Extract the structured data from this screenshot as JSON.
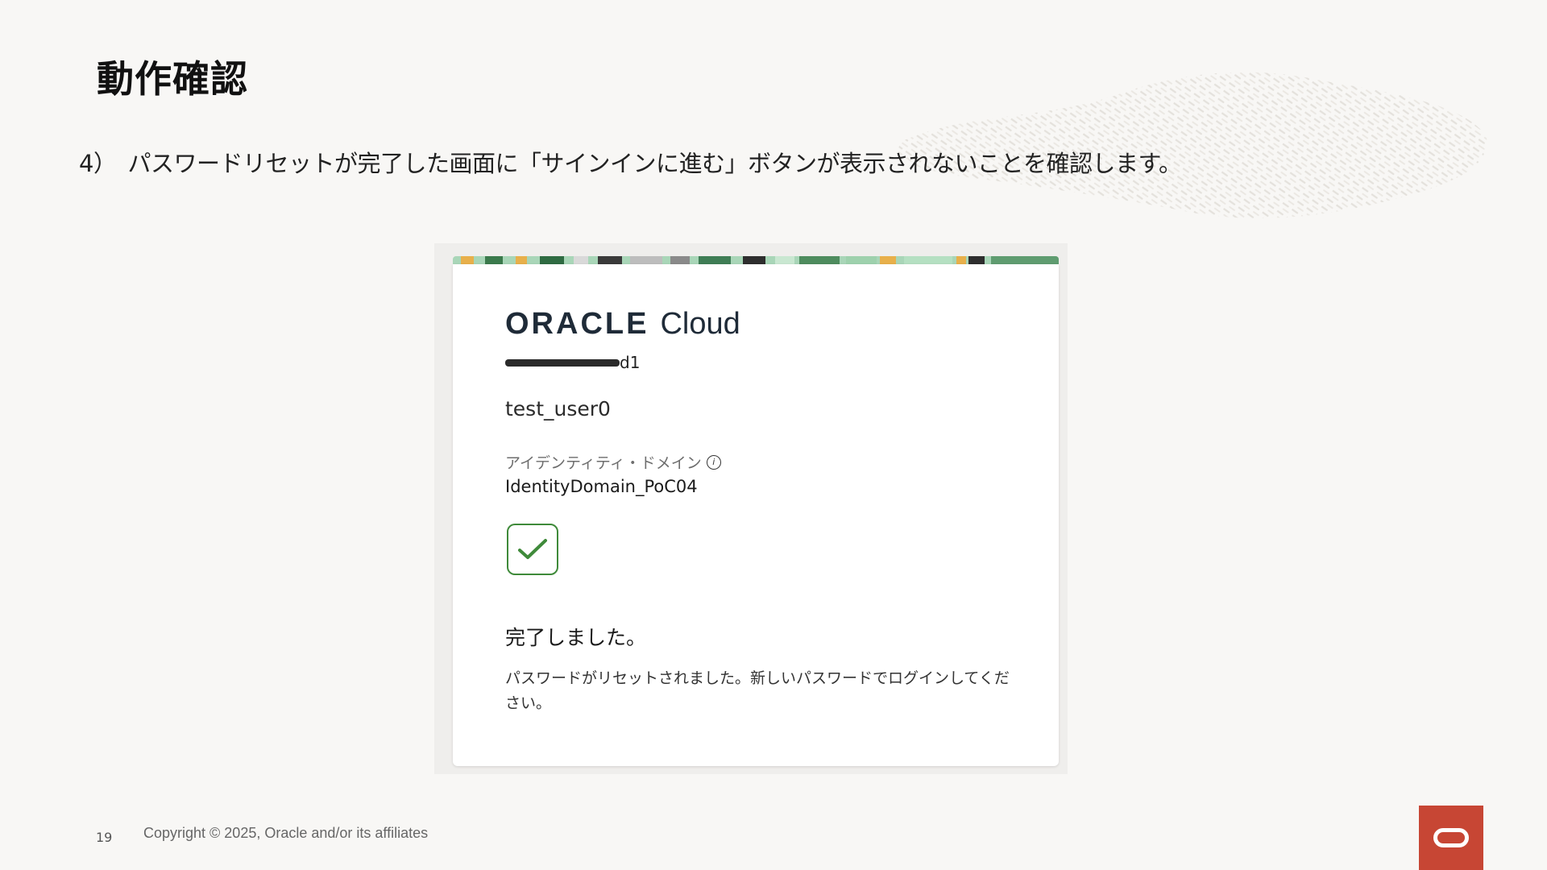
{
  "slide": {
    "title": "動作確認",
    "instruction": "4）　パスワードリセットが完了した画面に「サインインに進む」ボタンが表示されないことを確認します。",
    "page_number": "19",
    "copyright": "Copyright © 2025, Oracle and/or its affiliates"
  },
  "card": {
    "brand_oracle": "ORACLE",
    "brand_cloud": "Cloud",
    "tenant_suffix": "d1",
    "user_name": "test_user0",
    "domain_label": "アイデンティティ・ドメイン",
    "domain_value": "IdentityDomain_PoC04",
    "done_title": "完了しました。",
    "done_message": "パスワードがリセットされました。新しいパスワードでログインしてください。"
  },
  "icons": {
    "info": "info-icon",
    "check": "checkmark-icon",
    "logo": "oracle-logo"
  },
  "colors": {
    "oracle_red": "#c74634",
    "check_green": "#3f8a3a",
    "brand_navy": "#1f2b38"
  }
}
